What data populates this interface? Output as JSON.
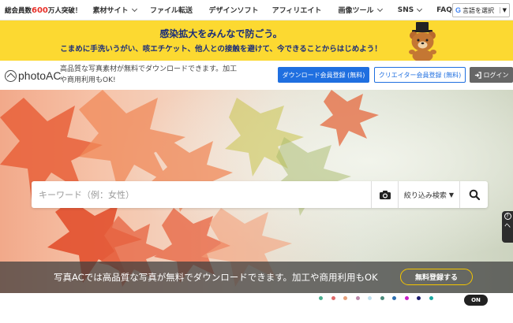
{
  "topnav": {
    "members_prefix": "総会員数",
    "members_count": "600",
    "members_suffix": "万人突破！",
    "items": [
      {
        "label": "素材サイト"
      },
      {
        "label": "ファイル転送"
      },
      {
        "label": "デザインソフト"
      },
      {
        "label": "アフィリエイト"
      },
      {
        "label": "画像ツール"
      },
      {
        "label": "SNS"
      },
      {
        "label": "FAQ"
      }
    ],
    "language_select": "言語を選択"
  },
  "banner": {
    "line1": "感染拡大をみんなで防ごう。",
    "line2": "こまめに手洗いうがい、咳エチケット、他人との接触を避けて、今できることからはじめよう！"
  },
  "header": {
    "logo_text": "photo",
    "logo_text_accent": "AC",
    "tagline": "高品質な写真素材が無料でダウンロードできます。加工や商用利用もOK!",
    "download_signup": "ダウンロード会員登録 (無料)",
    "creator_signup": "クリエイター会員登録 (無料)",
    "login": "ログイン"
  },
  "search": {
    "placeholder": "キーワード（例：女性）",
    "filter_label": "絞り込み検索"
  },
  "hero": {
    "message": "写真ACでは高品質な写真が無料でダウンロードできます。加工や商用利用もOK",
    "free_signup": "無料登録する"
  },
  "help_tab": "ヘ",
  "palette": {
    "colors": [
      "#4caf8f",
      "#e06a6a",
      "#e6a07a",
      "#bb8aaa",
      "#bfe0ee",
      "#4a8a7a",
      "#2d6fb0",
      "#c91ec9",
      "#1c1c6e",
      "#1aa7a0"
    ],
    "toggle_label": "ON"
  },
  "colors": {
    "banner_bg": "#fcd931",
    "banner_text": "#1a2d7a",
    "primary_blue": "#1f6fe0",
    "member_count": "#e8312a",
    "free_signup_border": "#f4c500"
  }
}
